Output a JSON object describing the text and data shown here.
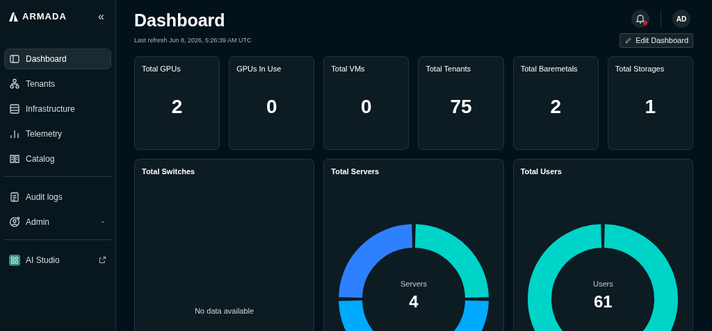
{
  "sidebar": {
    "brand": "ARMADA",
    "collapse": "«",
    "sections": [
      {
        "items": [
          {
            "label": "Dashboard",
            "kind": "plain",
            "selected": true
          },
          {
            "label": "Tenants",
            "kind": "plain",
            "selected": false
          },
          {
            "label": "Infrastructure",
            "kind": "plain",
            "selected": false
          },
          {
            "label": "Telemetry",
            "kind": "plain",
            "selected": false
          },
          {
            "label": "Catalog",
            "kind": "plain",
            "selected": false
          }
        ]
      },
      {
        "items": [
          {
            "label": "Audit logs",
            "kind": "plain",
            "selected": false
          },
          {
            "label": "Admin",
            "kind": "expandable",
            "selected": false
          }
        ]
      },
      {
        "items": [
          {
            "label": "AI Studio",
            "kind": "external",
            "selected": false
          }
        ]
      }
    ]
  },
  "header": {
    "title": "Dashboard",
    "last_refresh": "Last refresh Jun 8, 2026, 5:26:39 AM UTC",
    "notifications_unread": true,
    "avatar": "AD",
    "edit_button": "Edit Dashboard"
  },
  "stats": [
    {
      "title": "Total GPUs",
      "value": "2"
    },
    {
      "title": "GPUs In Use",
      "value": "0"
    },
    {
      "title": "Total VMs",
      "value": "0"
    },
    {
      "title": "Total Tenants",
      "value": "75"
    },
    {
      "title": "Total Baremetals",
      "value": "2"
    },
    {
      "title": "Total Storages",
      "value": "1"
    }
  ],
  "panels": [
    {
      "title": "Total Switches",
      "kind": "empty",
      "message": "No data available"
    },
    {
      "title": "Total Servers",
      "kind": "donut-quarters",
      "center_label": "Servers",
      "center_value": "4"
    },
    {
      "title": "Total Users",
      "kind": "donut-full",
      "center_label": "Users",
      "center_value": "61"
    }
  ]
}
